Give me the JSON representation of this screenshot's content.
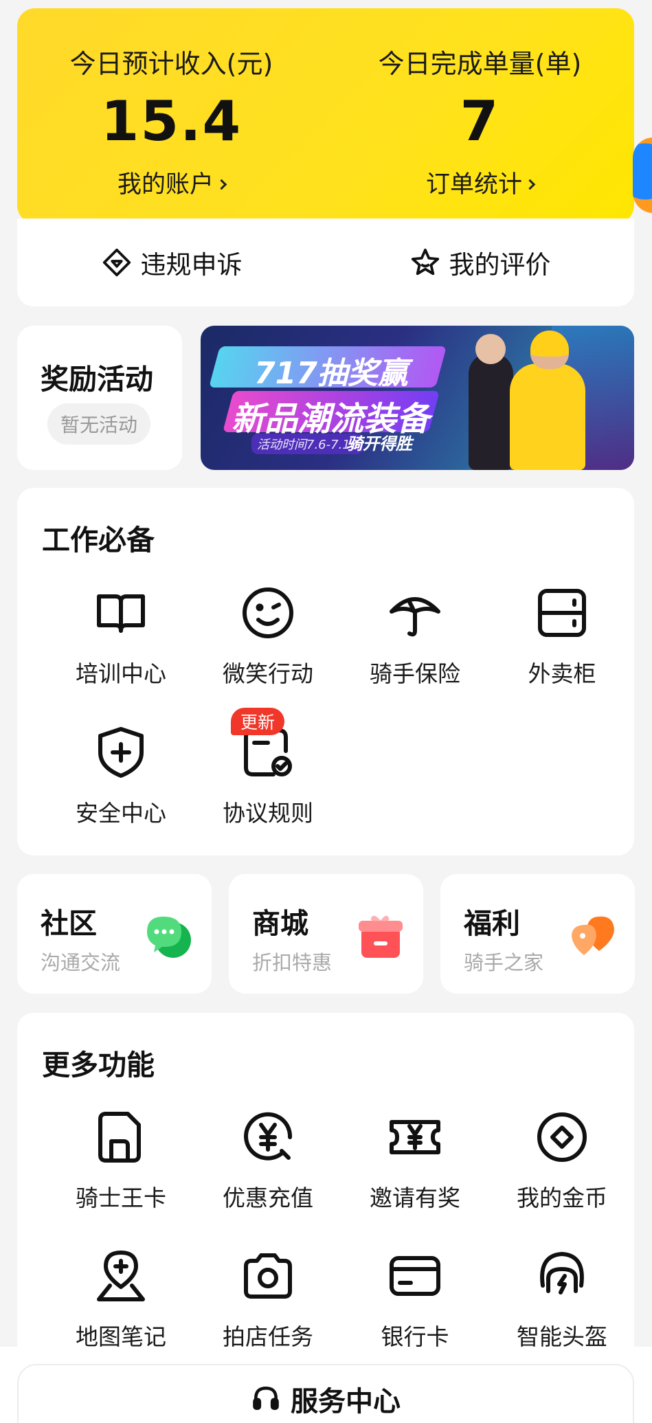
{
  "stats": {
    "income": {
      "label": "今日预计收入(元)",
      "value": "15.4",
      "link": "我的账户"
    },
    "orders": {
      "label": "今日完成单量(单)",
      "value": "7",
      "link": "订单统计"
    }
  },
  "actions": {
    "appeal": "违规申诉",
    "rating": "我的评价"
  },
  "rewards": {
    "title": "奖励活动",
    "empty": "暂无活动",
    "banner": {
      "line1": "717抽奖赢",
      "line2": "新品潮流装备",
      "date": "活动时间7.6-7.10",
      "slogan": "骑开得胜"
    }
  },
  "work": {
    "title": "工作必备",
    "items": [
      {
        "label": "培训中心",
        "icon": "book-icon"
      },
      {
        "label": "微笑行动",
        "icon": "smile-icon"
      },
      {
        "label": "骑手保险",
        "icon": "umbrella-icon"
      },
      {
        "label": "外卖柜",
        "icon": "locker-icon"
      },
      {
        "label": "安全中心",
        "icon": "shield-plus-icon"
      },
      {
        "label": "协议规则",
        "icon": "document-check-icon"
      }
    ],
    "badge": "更新"
  },
  "mini_cards": [
    {
      "title": "社区",
      "sub": "沟通交流",
      "icon": "chat-bubble-icon",
      "color": "#27c45b"
    },
    {
      "title": "商城",
      "sub": "折扣特惠",
      "icon": "gift-icon",
      "color": "#ff5a5f"
    },
    {
      "title": "福利",
      "sub": "骑手之家",
      "icon": "heart-tag-icon",
      "color": "#ff8a2a"
    }
  ],
  "more": {
    "title": "更多功能",
    "items": [
      {
        "label": "骑士王卡",
        "icon": "sim-card-icon"
      },
      {
        "label": "优惠充值",
        "icon": "yuan-coin-icon"
      },
      {
        "label": "邀请有奖",
        "icon": "ticket-icon"
      },
      {
        "label": "我的金币",
        "icon": "gold-coin-icon"
      },
      {
        "label": "地图笔记",
        "icon": "map-pin-icon"
      },
      {
        "label": "拍店任务",
        "icon": "camera-icon"
      },
      {
        "label": "银行卡",
        "icon": "bank-card-icon"
      },
      {
        "label": "智能头盔",
        "icon": "helmet-icon"
      }
    ]
  },
  "service": {
    "label": "服务中心",
    "icon": "headset-icon"
  },
  "colors": {
    "brand_yellow": "#ffe21d",
    "badge_red": "#f0372a"
  }
}
